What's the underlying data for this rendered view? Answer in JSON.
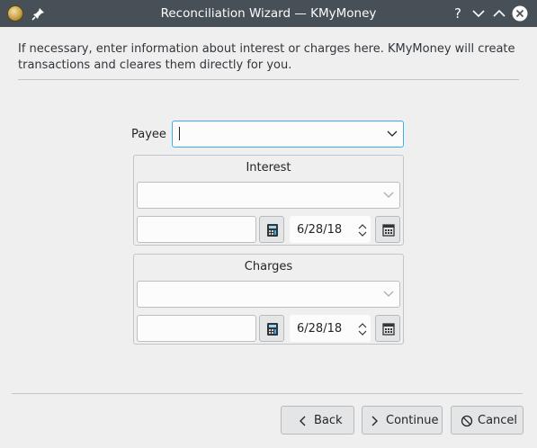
{
  "window": {
    "title": "Reconciliation Wizard — KMyMoney"
  },
  "intro_text": "If necessary, enter information about interest or charges here. KMyMoney will create transactions and cleares them directly for you.",
  "payee": {
    "label": "Payee",
    "value": ""
  },
  "interest": {
    "title": "Interest",
    "category_value": "",
    "amount_value": "",
    "date": "6/28/18"
  },
  "charges": {
    "title": "Charges",
    "category_value": "",
    "amount_value": "",
    "date": "6/28/18"
  },
  "buttons": {
    "back": "Back",
    "continue": "Continue",
    "cancel": "Cancel"
  },
  "icons": {
    "app": "kmymoney-coin-icon",
    "pin": "pin-icon",
    "help": "help-icon",
    "minimize": "minimize-icon",
    "maximize": "maximize-icon",
    "close": "close-icon",
    "calculator": "calculator-icon",
    "calendar": "calendar-icon"
  },
  "colors": {
    "titlebar": "#475057",
    "accent": "#3daee9",
    "window_bg": "#efefef"
  }
}
